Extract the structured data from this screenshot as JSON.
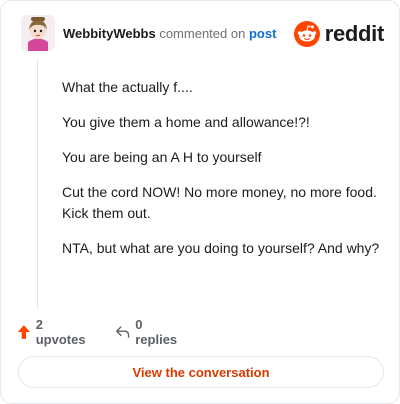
{
  "comment": {
    "author": "WebbityWebbs",
    "verb": "commented on",
    "link_text": "post",
    "paragraphs": [
      "What the actually f....",
      "You give them a home and allowance!?!",
      "You are being an A H to yourself",
      "Cut the cord NOW! No more money, no more food. Kick them out.",
      "NTA, but what are you doing to yourself? And why?"
    ]
  },
  "brand": {
    "name": "reddit",
    "icon": "reddit-snoo-icon",
    "color": "#ff4500"
  },
  "actions": {
    "upvotes_label": "2 upvotes",
    "upvote_icon": "upvote-arrow-icon",
    "replies_label": "0 replies",
    "reply_icon": "reply-arrow-icon"
  },
  "cta": {
    "label": "View the conversation"
  },
  "colors": {
    "accent": "#d93a00",
    "link": "#0f6ed5",
    "upvote": "#ff4500"
  }
}
